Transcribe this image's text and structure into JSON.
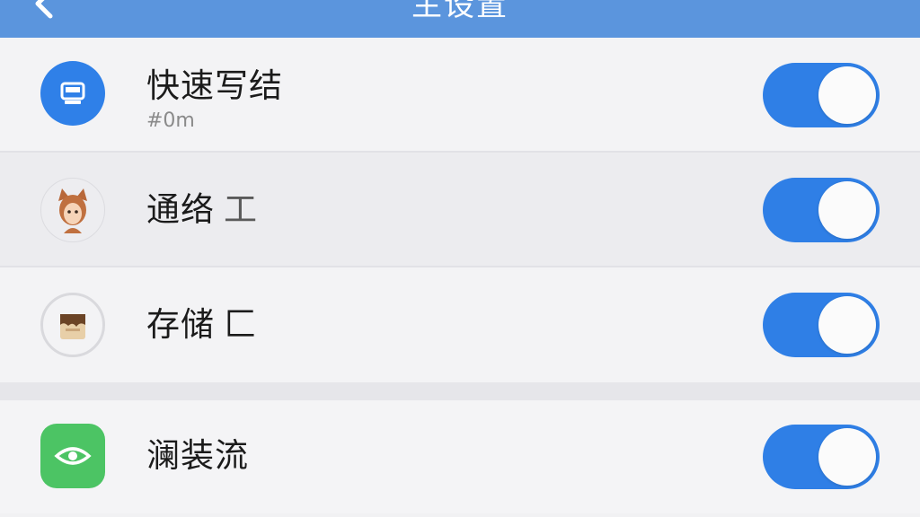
{
  "header": {
    "title": "主设置"
  },
  "settings": [
    {
      "title": "快速写结",
      "subtitle": "#0m",
      "suffix": "",
      "icon": "monitor-icon",
      "enabled": true
    },
    {
      "title": "通络",
      "subtitle": "",
      "suffix": "工",
      "icon": "fox-avatar-icon",
      "enabled": true
    },
    {
      "title": "存储",
      "subtitle": "",
      "suffix": "匚",
      "icon": "storage-box-icon",
      "enabled": true
    },
    {
      "title": "澜装流",
      "subtitle": "",
      "suffix": "",
      "icon": "eye-icon",
      "enabled": true
    }
  ],
  "colors": {
    "topbar": "#5b95dd",
    "toggle_on": "#2f7fe6",
    "icon_blue": "#2f80e8",
    "icon_green": "#4cc464"
  }
}
